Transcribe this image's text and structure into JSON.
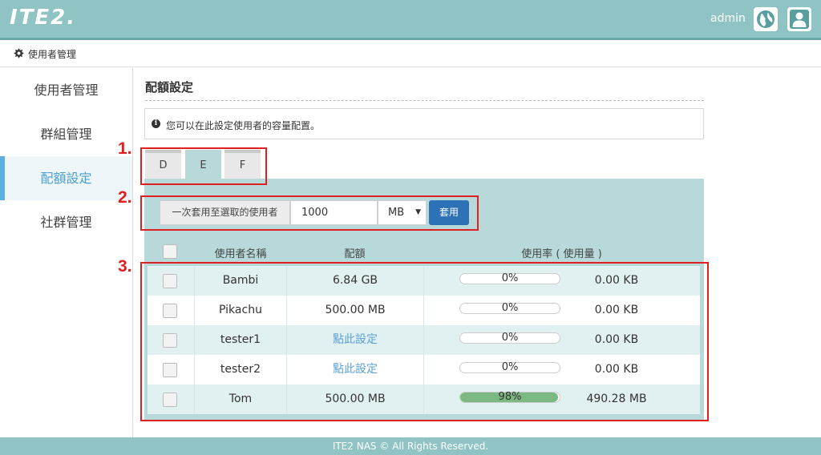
{
  "header": {
    "logo": "ITE2.",
    "user_name": "admin",
    "globe_icon": "globe-icon",
    "user_icon": "user-icon",
    "bar_color": "#8fc3c4"
  },
  "breadcrumb": {
    "icon": "gear-icon",
    "text": "使用者管理"
  },
  "sidebar": {
    "items": [
      {
        "label": "使用者管理"
      },
      {
        "label": "群組管理"
      },
      {
        "label": "配額設定"
      },
      {
        "label": "社群管理"
      }
    ],
    "active_index": 2
  },
  "main": {
    "title": "配額設定",
    "info_icon": "info-icon",
    "info_text": "您可以在此設定使用者的容量配置。",
    "tabs": [
      {
        "label": "D"
      },
      {
        "label": "E"
      },
      {
        "label": "F"
      }
    ],
    "active_tab": "E",
    "apply": {
      "label": "一次套用至選取的使用者",
      "value": "1000",
      "unit": "MB",
      "button": "套用"
    },
    "table": {
      "headers": {
        "name": "使用者名稱",
        "quota": "配額",
        "usage": "使用率 ( 使用量 )"
      },
      "rows": [
        {
          "name": "Bambi",
          "quota": "6.84 GB",
          "percent_label": "0%",
          "percent": 0,
          "used": "0.00 KB"
        },
        {
          "name": "Pikachu",
          "quota": "500.00 MB",
          "percent_label": "0%",
          "percent": 0,
          "used": "0.00 KB"
        },
        {
          "name": "tester1",
          "quota": "點此設定",
          "percent_label": "0%",
          "percent": 0,
          "used": "0.00 KB"
        },
        {
          "name": "tester2",
          "quota": "點此設定",
          "percent_label": "0%",
          "percent": 0,
          "used": "0.00 KB"
        },
        {
          "name": "Tom",
          "quota": "500.00 MB",
          "percent_label": "98%",
          "percent": 98,
          "used": "490.28 MB"
        }
      ]
    }
  },
  "annotations": {
    "one": "1.",
    "two": "2.",
    "three": "3.",
    "color": "#e02020"
  },
  "footer": {
    "text": "ITE2 NAS © All Rights Reserved."
  }
}
